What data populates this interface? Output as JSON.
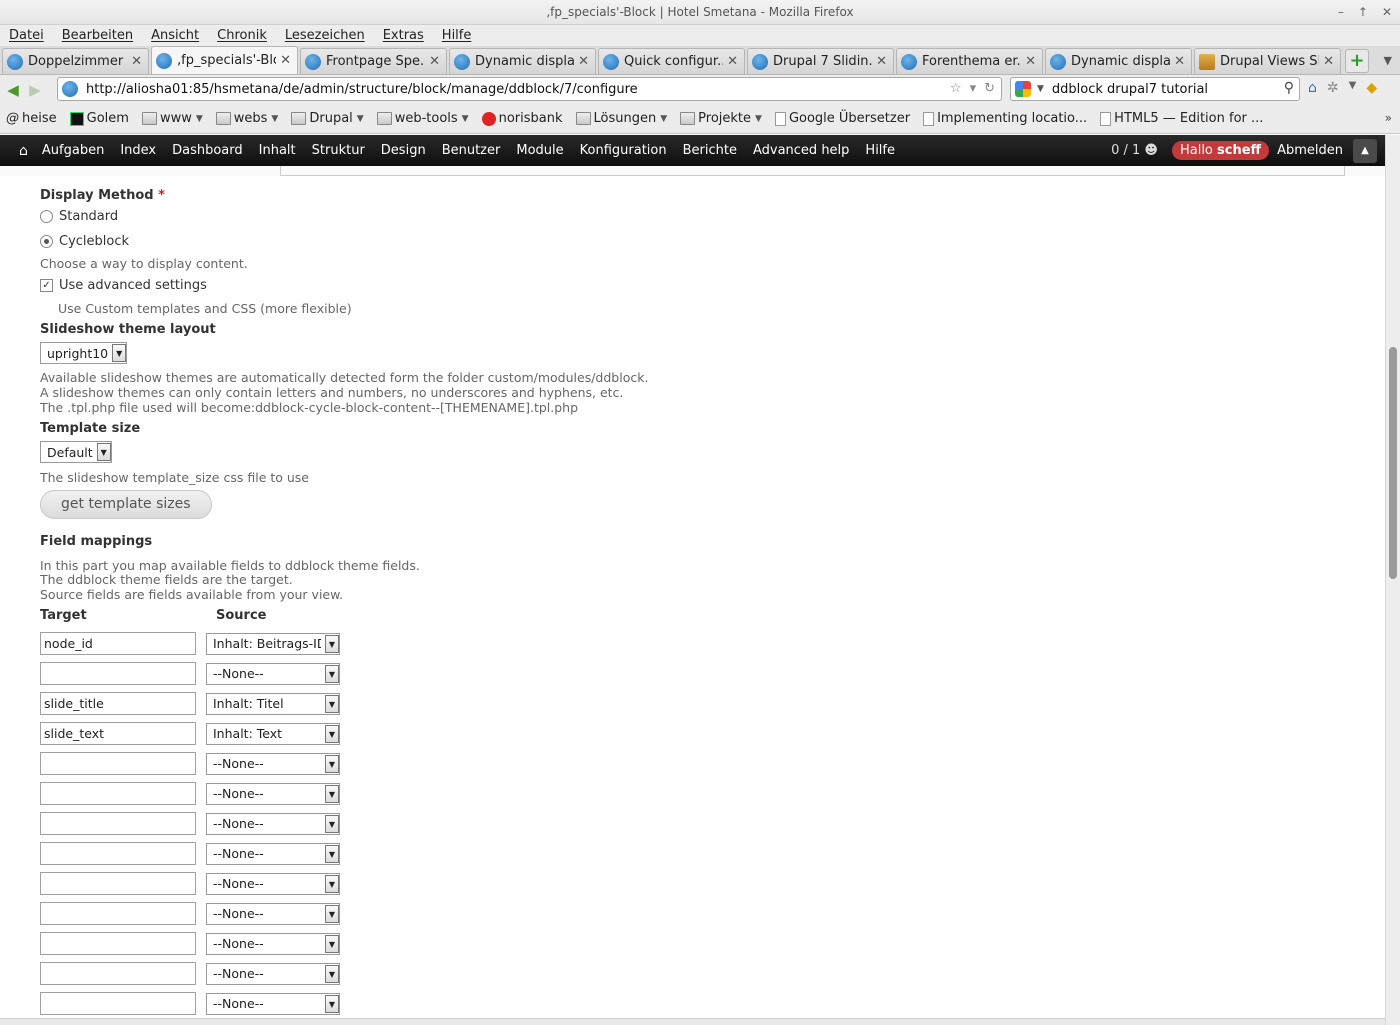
{
  "window": {
    "title": "‚fp_specials'-Block | Hotel Smetana - Mozilla Firefox",
    "controls": [
      "–",
      "↑",
      "✕"
    ]
  },
  "menu": [
    "Datei",
    "Bearbeiten",
    "Ansicht",
    "Chronik",
    "Lesezeichen",
    "Extras",
    "Hilfe"
  ],
  "tabs": [
    {
      "label": "Doppelzimmer ...",
      "icon": "drupal-icon"
    },
    {
      "label": "‚fp_specials'-Blo...",
      "icon": "drupal-icon"
    },
    {
      "label": "Frontpage Spe...",
      "icon": "drupal-icon"
    },
    {
      "label": "Dynamic displa...",
      "icon": "drupal-icon"
    },
    {
      "label": "Quick configur...",
      "icon": "drupal-icon"
    },
    {
      "label": "Drupal 7 Slidin...",
      "icon": "drupal-icon"
    },
    {
      "label": "Forenthema er...",
      "icon": "drupal-icon"
    },
    {
      "label": "Dynamic displa...",
      "icon": "drupal-icon"
    },
    {
      "label": "Drupal Views Sl...",
      "icon": "page-icon"
    }
  ],
  "tab_close": "✕",
  "newtab": "+",
  "nav": {
    "back": "◀",
    "forward": "▶",
    "url": "http://aliosha01:85/hsmetana/de/admin/structure/block/manage/ddblock/7/configure",
    "star": "☆",
    "dropdown": "▾",
    "reload": "↻",
    "search": "ddblock drupal7 tutorial",
    "search_icon": "⚲"
  },
  "bookmarks": [
    {
      "label": "heise",
      "type": "at"
    },
    {
      "label": "Golem",
      "type": "golem"
    },
    {
      "label": "www",
      "type": "folder",
      "dd": true
    },
    {
      "label": "webs",
      "type": "folder",
      "dd": true
    },
    {
      "label": "Drupal",
      "type": "folder",
      "dd": true
    },
    {
      "label": "web-tools",
      "type": "folder",
      "dd": true
    },
    {
      "label": "norisbank",
      "type": "round"
    },
    {
      "label": "Lösungen",
      "type": "folder",
      "dd": true
    },
    {
      "label": "Projekte",
      "type": "folder",
      "dd": true
    },
    {
      "label": "Google Übersetzer",
      "type": "page"
    },
    {
      "label": "Implementing locatio...",
      "type": "page"
    },
    {
      "label": "HTML5 — Edition for ...",
      "type": "page"
    }
  ],
  "bookmarks_more": "»",
  "toolbar": {
    "items": [
      "Aufgaben",
      "Index",
      "Dashboard",
      "Inhalt",
      "Struktur",
      "Design",
      "Benutzer",
      "Module",
      "Konfiguration",
      "Berichte",
      "Advanced help",
      "Hilfe"
    ],
    "counter": "0 / 1",
    "hello_prefix": "Hallo",
    "hello_user": "scheff",
    "logout": "Abmelden"
  },
  "form": {
    "display_method_label": "Display Method",
    "required_mark": "*",
    "radio_standard": "Standard",
    "radio_cycleblock": "Cycleblock",
    "display_method_desc": "Choose a way to display content.",
    "advanced_checkbox": "Use advanced settings",
    "advanced_desc": "Use Custom templates and CSS (more flexible)",
    "theme_layout_label": "Slideshow theme layout",
    "theme_layout_value": "upright10",
    "theme_desc_1": "Available slideshow themes are automatically detected form the folder custom/modules/ddblock.",
    "theme_desc_2": "A slideshow themes can only contain letters and numbers, no underscores and hyphens, etc.",
    "theme_desc_3": "The .tpl.php file used will become:ddblock-cycle-block-content--[THEMENAME].tpl.php",
    "template_size_label": "Template size",
    "template_size_value": "Default",
    "template_size_desc": "The slideshow template_size css file to use",
    "get_sizes_button": "get template sizes",
    "field_mappings_label": "Field mappings",
    "fm_desc_1": "In this part you map available fields to ddblock theme fields.",
    "fm_desc_2": "The ddblock theme fields are the target.",
    "fm_desc_3": "Source fields are fields available from your view.",
    "col_target": "Target",
    "col_source": "Source",
    "mappings": [
      {
        "target": "node_id",
        "source": "Inhalt: Beitrags-ID"
      },
      {
        "target": "",
        "source": "--None--"
      },
      {
        "target": "slide_title",
        "source": "Inhalt: Titel"
      },
      {
        "target": "slide_text",
        "source": "Inhalt: Text"
      },
      {
        "target": "",
        "source": "--None--"
      },
      {
        "target": "",
        "source": "--None--"
      },
      {
        "target": "",
        "source": "--None--"
      },
      {
        "target": "",
        "source": "--None--"
      },
      {
        "target": "",
        "source": "--None--"
      },
      {
        "target": "",
        "source": "--None--"
      },
      {
        "target": "",
        "source": "--None--"
      },
      {
        "target": "",
        "source": "--None--"
      },
      {
        "target": "",
        "source": "--None--"
      }
    ]
  },
  "colors": {
    "toolbar_bg": "#1a1a1a",
    "hello_badge": "#c23a3a",
    "required": "#d42020"
  }
}
